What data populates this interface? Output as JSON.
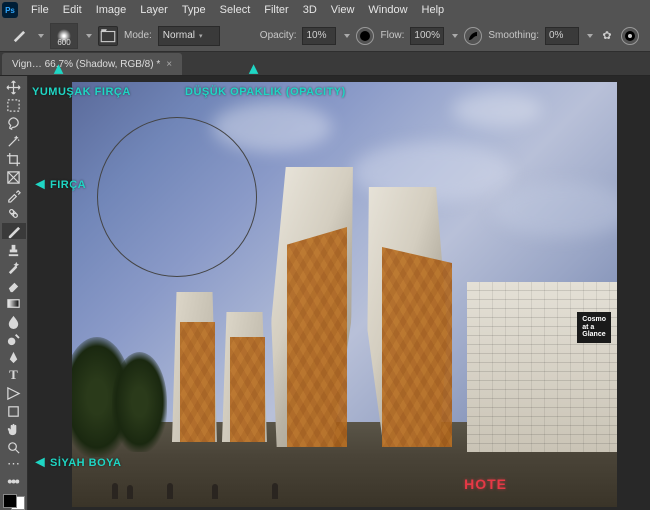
{
  "app": {
    "logo": "Ps"
  },
  "menu": [
    "File",
    "Edit",
    "Image",
    "Layer",
    "Type",
    "Select",
    "Filter",
    "3D",
    "View",
    "Window",
    "Help"
  ],
  "options": {
    "brush_size": "600",
    "mode_label": "Mode:",
    "mode_value": "Normal",
    "opacity_label": "Opacity:",
    "opacity_value": "10%",
    "flow_label": "Flow:",
    "flow_value": "100%",
    "smoothing_label": "Smoothing:",
    "smoothing_value": "0%"
  },
  "tab": {
    "title": "Vign… 66,7% (Shadow, RGB/8) *"
  },
  "annotations": {
    "soft_brush": "YUMUŞAK FIRÇA",
    "low_opacity": "DÜŞÜK OPAKLIK (OPACITY)",
    "brush": "FIRÇA",
    "black_paint": "SİYAH BOYA"
  },
  "canvas": {
    "sign1": "Cosmo",
    "sign1b": "at a",
    "sign1c": "Glance",
    "sign2": "HOTE"
  }
}
